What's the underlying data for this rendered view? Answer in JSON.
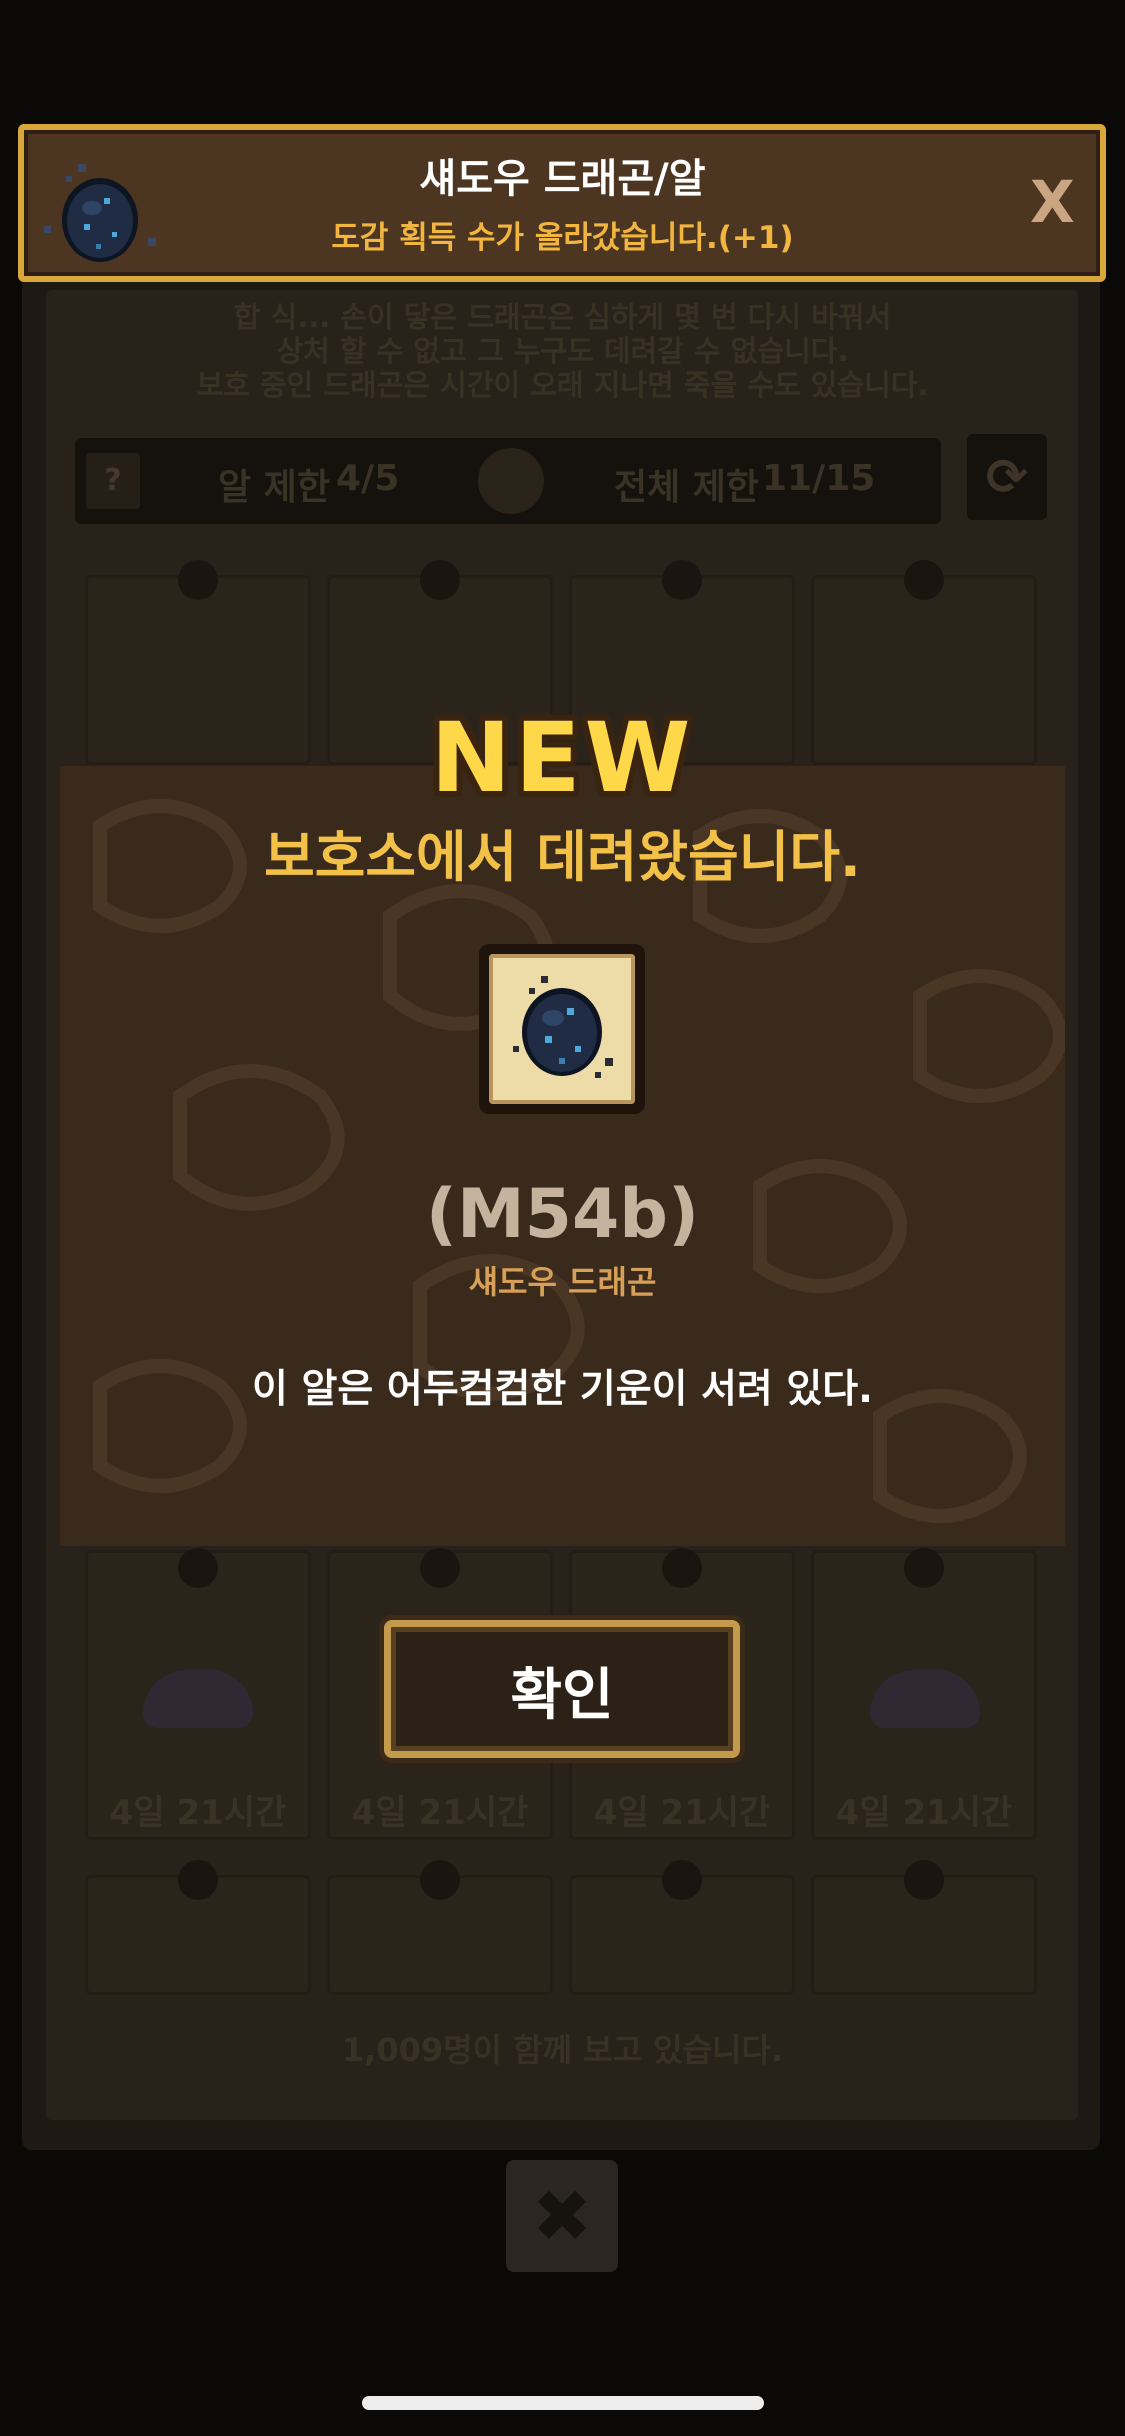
{
  "banner": {
    "title": "섀도우 드래곤/알",
    "subtitle": "도감 획득 수가 올라갔습니다.(+1)",
    "close_label": "X",
    "icon": "dragon-egg-icon"
  },
  "background": {
    "info_lines": [
      "합 식... 손이 닿은 드래곤은 심하게 몇 번 다시 바꿔서",
      "상처 할 수 없고 그 누구도 데려갈 수 없습니다.",
      "보호 중인 드래곤은 시간이 오래 지나면 죽을 수도 있습니다."
    ],
    "egg_limit_label": "알 제한",
    "egg_limit_value": "4/5",
    "total_limit_label": "전체 제한",
    "total_limit_value": "11/15",
    "help_label": "?",
    "refresh_icon": "refresh-icon",
    "card_timers": [
      "4일 21시간",
      "4일 21시간",
      "4일 21시간",
      "4일 21시간"
    ],
    "viewers_text": "1,009명이 함께 보고 있습니다.",
    "close_icon": "close-icon"
  },
  "modal": {
    "badge": "NEW",
    "title": "보호소에서 데려왔습니다.",
    "item_code": "(M54b)",
    "item_name": "섀도우 드래곤",
    "description": "이 알은 어두컴컴한 기운이 서려 있다.",
    "confirm_label": "확인",
    "item_icon": "dragon-egg-icon"
  },
  "colors": {
    "accent_gold": "#f3c147",
    "banner_border": "#d9a63a",
    "subtitle_orange": "#f2b640",
    "egg_dark": "#1f2c44",
    "egg_spot": "#4fa9d8"
  }
}
